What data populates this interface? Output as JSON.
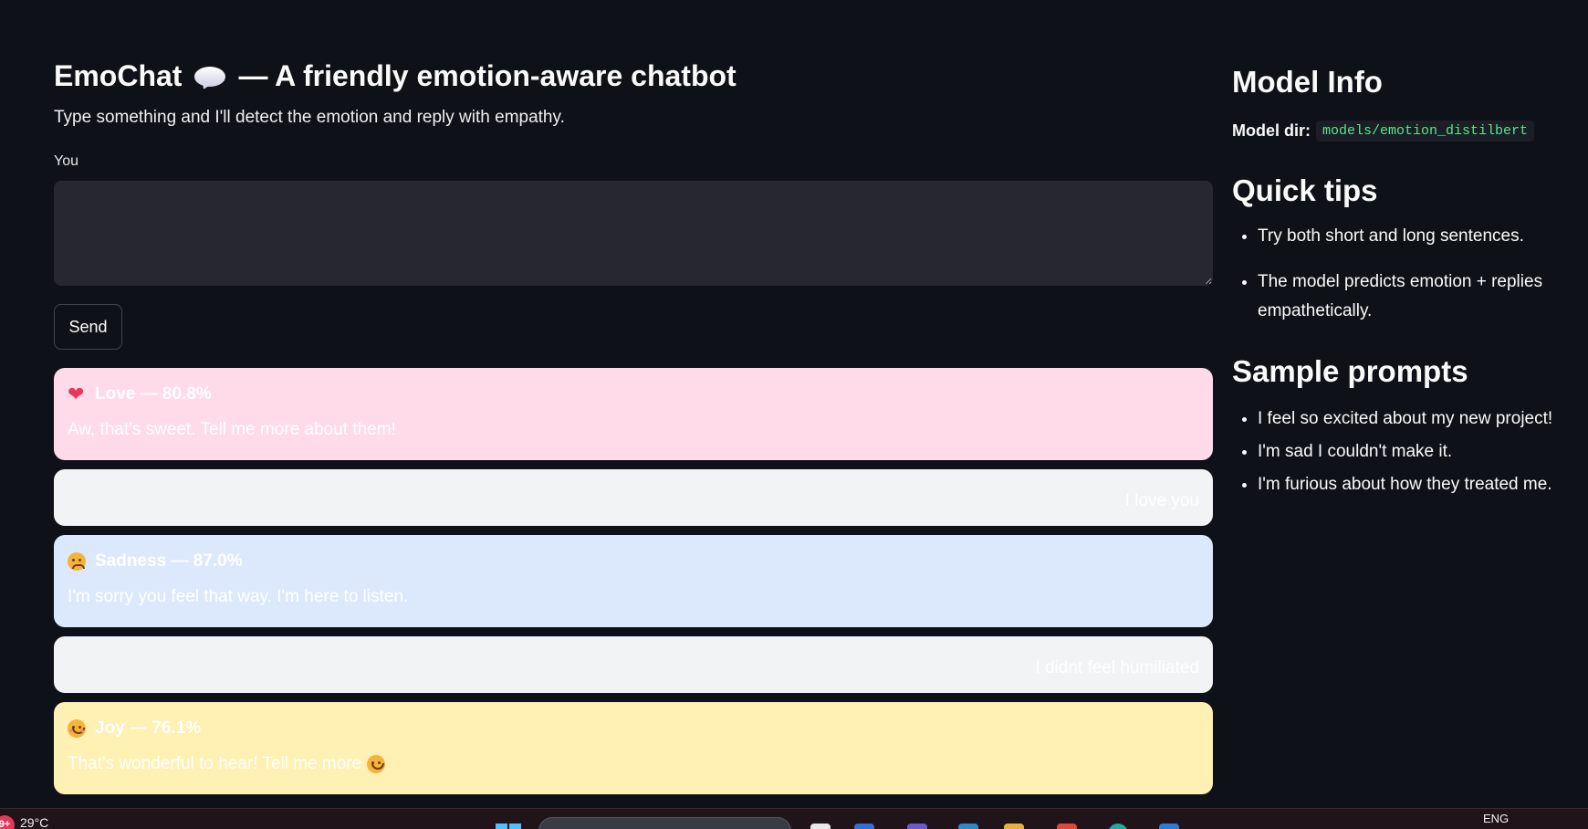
{
  "main": {
    "title": "EmoChat",
    "title_rest": "— A friendly emotion-aware chatbot",
    "title_emoji": "speech-bubble-icon",
    "subtitle": "Type something and I'll detect the emotion and reply with empathy.",
    "input_label": "You",
    "input_value": "",
    "send_label": "Send",
    "messages": [
      {
        "role": "bot",
        "icon": "heart-icon",
        "header": "Love — 80.8%",
        "reply": "Aw, that's sweet. Tell me more about them!",
        "bg": "#ffdbe9"
      },
      {
        "role": "user",
        "text": "I love you",
        "bg": "#f2f3f4"
      },
      {
        "role": "bot",
        "icon": "pensive-face-icon",
        "header": "Sadness — 87.0%",
        "reply": "I'm sorry you feel that way. I'm here to listen.",
        "bg": "#dce9fd"
      },
      {
        "role": "user",
        "text": "I didnt feel humiliated",
        "bg": "#f2f3f4"
      },
      {
        "role": "bot",
        "icon": "smiling-face-icon",
        "header": "Joy — 76.1%",
        "reply": "That's wonderful to hear! Tell me more",
        "reply_icon": "smiley-face-icon",
        "bg": "#fff0b3"
      }
    ]
  },
  "sidebar": {
    "model_info_heading": "Model Info",
    "model_dir_label": "Model dir:",
    "model_dir_value": "models/emotion_distilbert",
    "quick_tips_heading": "Quick tips",
    "tips": [
      "Try both short and long sentences.",
      "The model predicts emotion + replies empathetically."
    ],
    "sample_prompts_heading": "Sample prompts",
    "prompts": [
      "I feel so excited about my new project!",
      "I'm sad I couldn't make it.",
      "I'm furious about how they treated me."
    ]
  },
  "taskbar": {
    "weather_badge": "9+",
    "temperature": "29°C",
    "language": "ENG"
  },
  "colors": {
    "background": "#0e1117",
    "input_bg": "#262730",
    "code_green": "#5ce488",
    "love_bg": "#ffdbe9",
    "sadness_bg": "#dce9fd",
    "joy_bg": "#fff0b3",
    "user_bg": "#f2f3f4"
  }
}
